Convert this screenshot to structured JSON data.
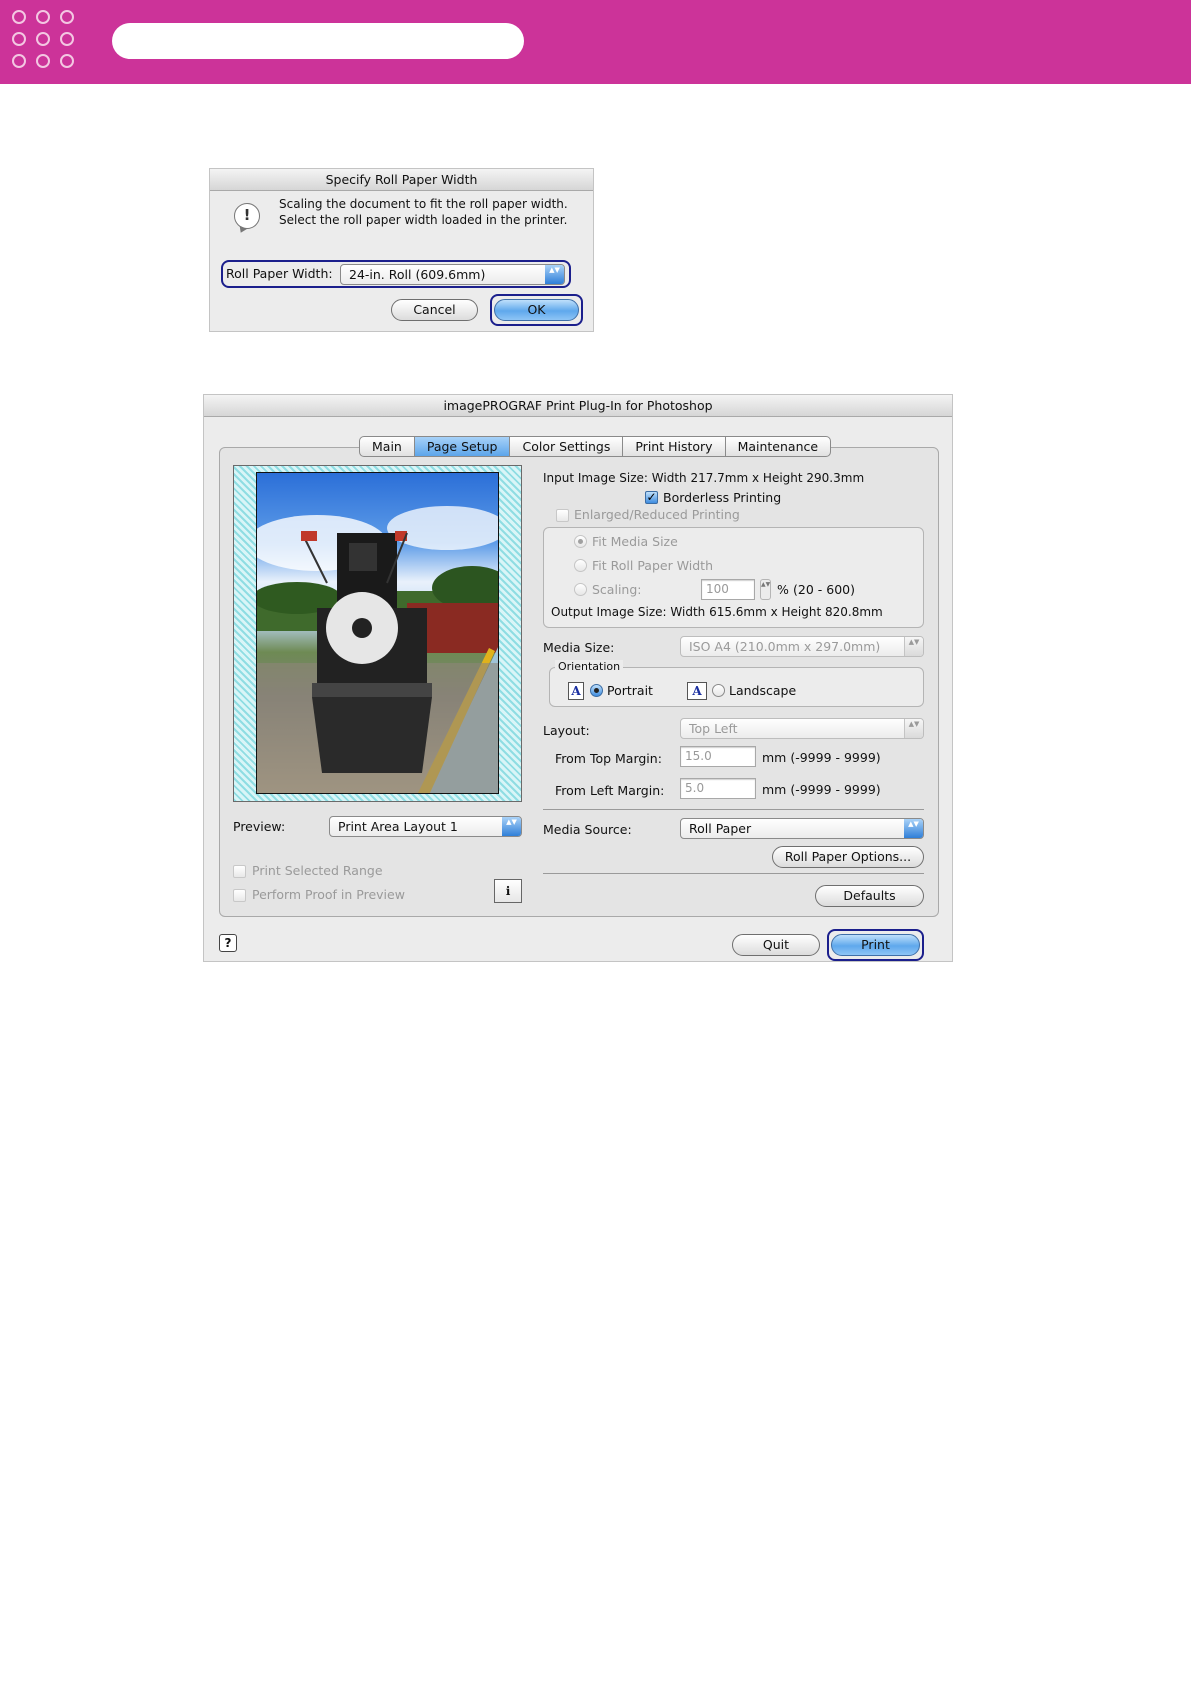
{
  "dialog1": {
    "title": "Specify Roll Paper Width",
    "icon": "alert-icon",
    "message_line1": "Scaling the document to fit the roll paper width.",
    "message_line2": "Select the roll paper width loaded in the printer.",
    "roll_paper_width_label": "Roll Paper Width:",
    "roll_paper_width_value": "24-in. Roll (609.6mm)",
    "cancel_label": "Cancel",
    "ok_label": "OK"
  },
  "dialog2": {
    "title": "imagePROGRAF Print Plug-In for Photoshop",
    "tabs": [
      {
        "label": "Main",
        "active": false
      },
      {
        "label": "Page Setup",
        "active": true
      },
      {
        "label": "Color Settings",
        "active": false
      },
      {
        "label": "Print History",
        "active": false
      },
      {
        "label": "Maintenance",
        "active": false
      }
    ],
    "input_image_size": "Input Image Size: Width 217.7mm x Height 290.3mm",
    "borderless_printing": {
      "label": "Borderless Printing",
      "checked": true
    },
    "enlarged_reduced": {
      "label": "Enlarged/Reduced Printing",
      "checked": false
    },
    "fit_media_size": "Fit Media Size",
    "fit_roll_paper_width": "Fit Roll Paper Width",
    "scaling_label": "Scaling:",
    "scaling_value": "100",
    "scaling_unit": "%",
    "scaling_range": "(20 - 600)",
    "output_image_size": "Output Image Size: Width 615.6mm x Height 820.8mm",
    "media_size_label": "Media Size:",
    "media_size_value": "ISO A4 (210.0mm x 297.0mm)",
    "orientation_legend": "Orientation",
    "orientation_icon_glyph": "A",
    "portrait_label": "Portrait",
    "landscape_label": "Landscape",
    "layout_label": "Layout:",
    "layout_value": "Top Left",
    "top_margin_label": "From Top Margin:",
    "top_margin_value": "15.0",
    "left_margin_label": "From Left Margin:",
    "left_margin_value": "5.0",
    "margin_range": "mm (-9999 - 9999)",
    "media_source_label": "Media Source:",
    "media_source_value": "Roll Paper",
    "roll_paper_options_label": "Roll Paper Options...",
    "defaults_label": "Defaults",
    "preview_label": "Preview:",
    "preview_value": "Print Area Layout 1",
    "print_selected_range": "Print Selected Range",
    "perform_proof": "Perform Proof in Preview",
    "help_glyph": "?",
    "quit_label": "Quit",
    "print_label": "Print"
  },
  "icons": {
    "popup_arrows": "▲▼",
    "check_mark": "✓",
    "proof_icon_glyph": "ℹ"
  }
}
